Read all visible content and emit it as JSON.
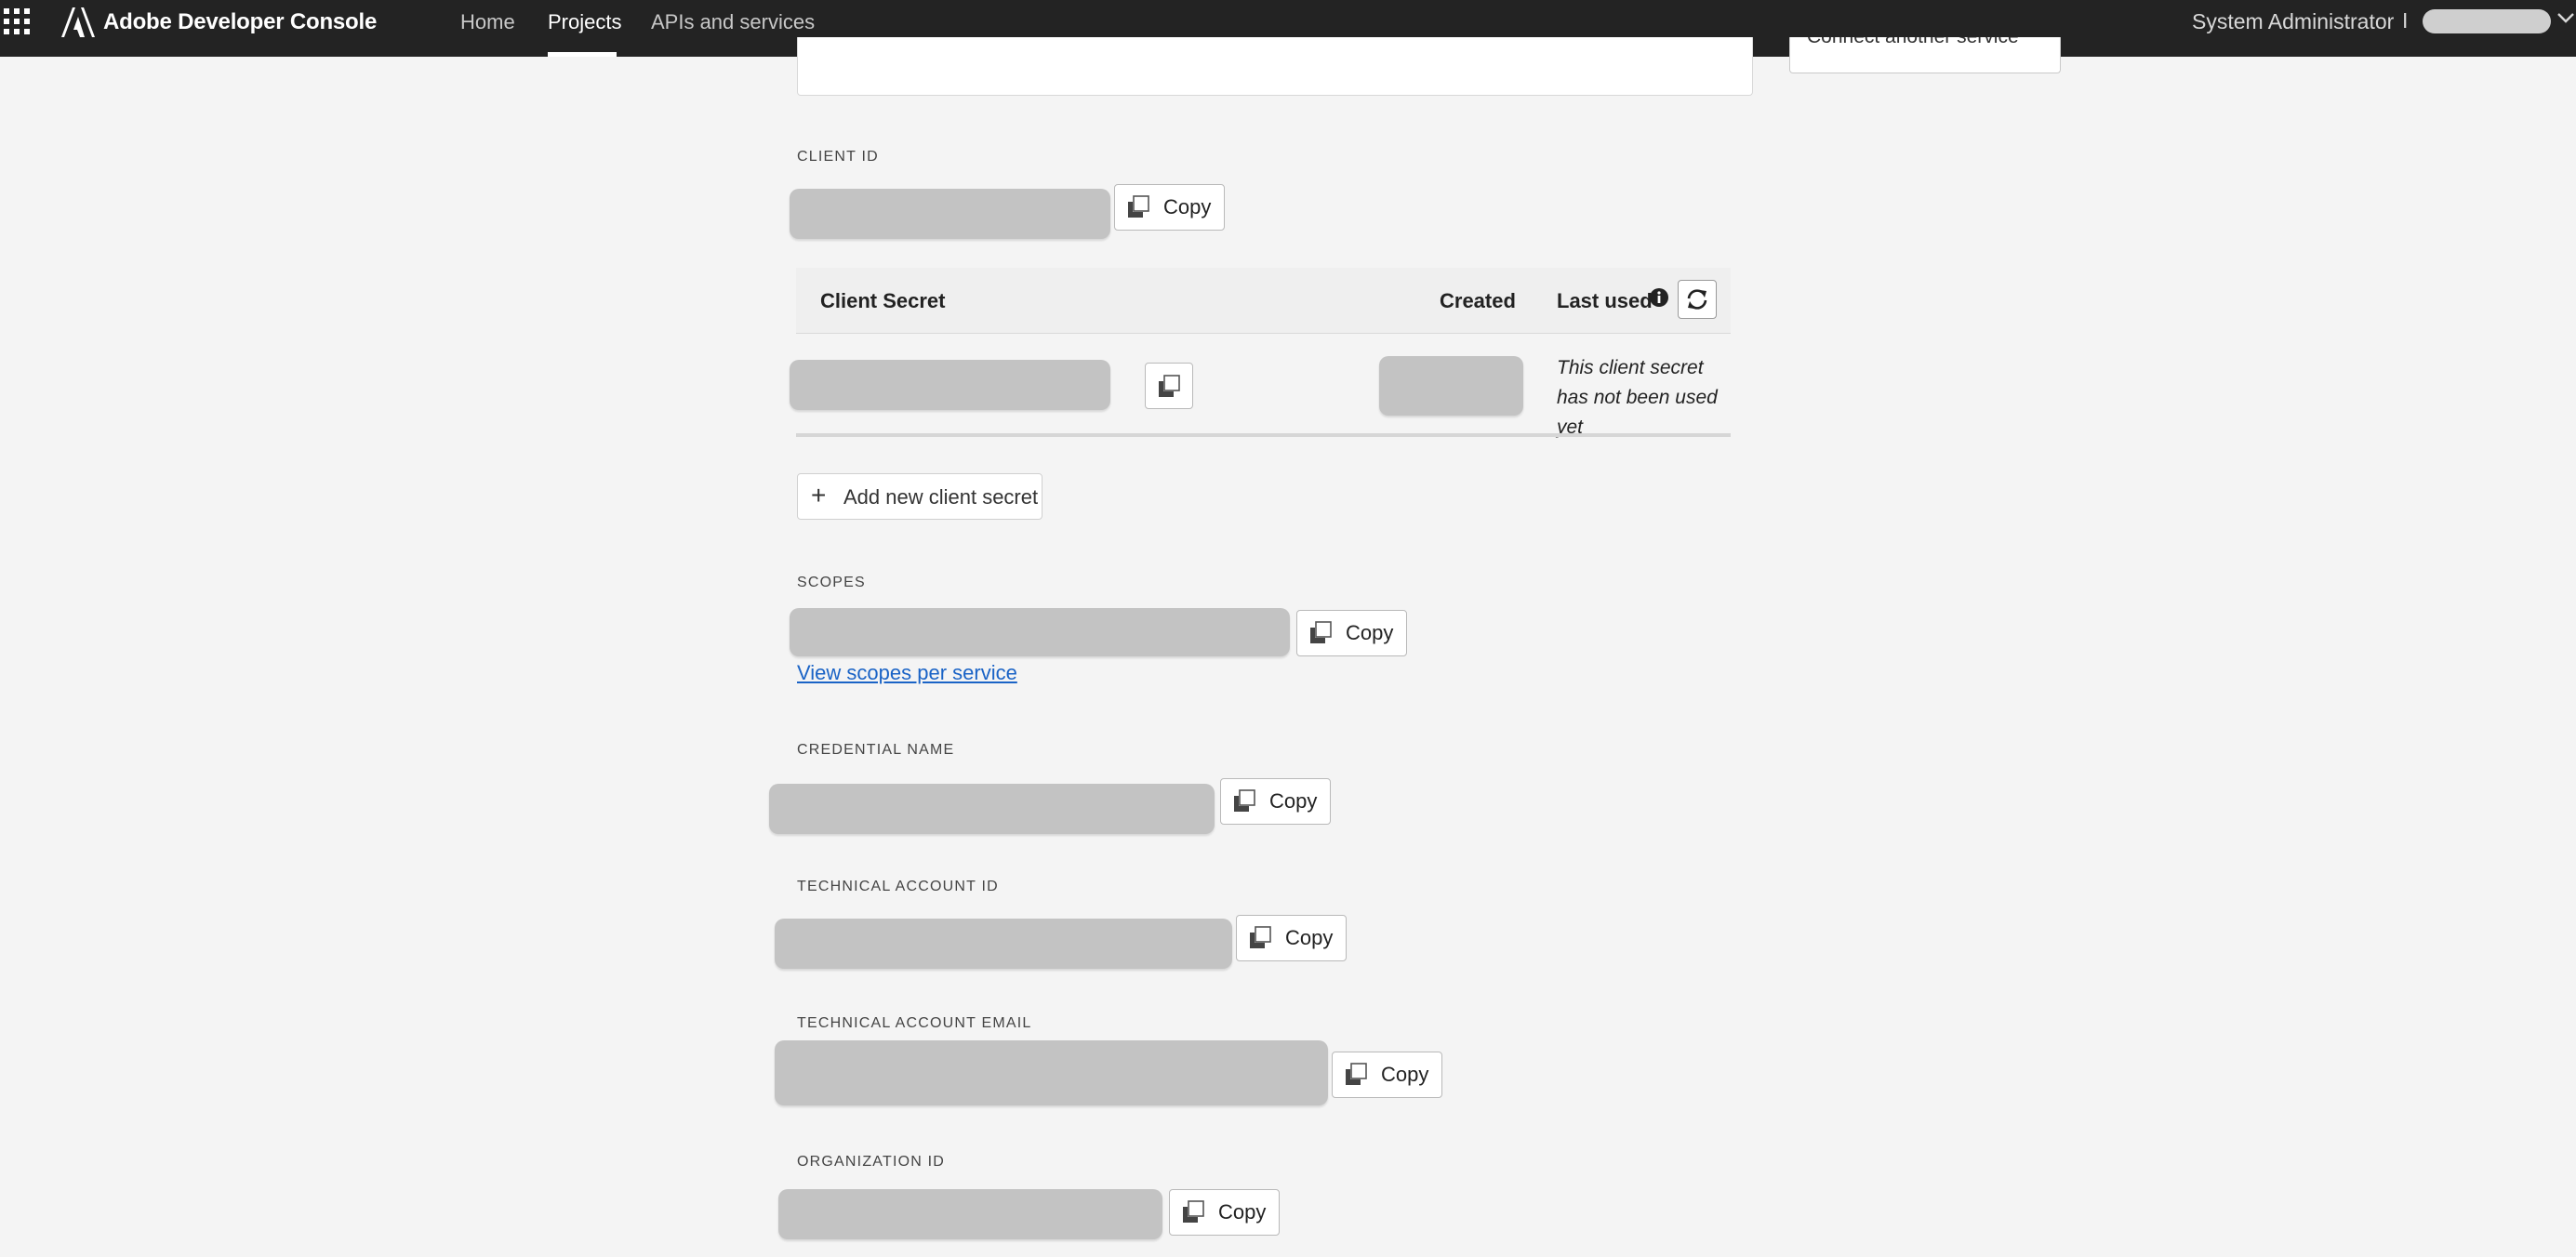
{
  "header": {
    "brand": "Adobe Developer Console",
    "nav": [
      {
        "label": "Home"
      },
      {
        "label": "Projects",
        "active": true
      },
      {
        "label": "APIs and services"
      }
    ],
    "user_name": "System Administrator",
    "separator": "I"
  },
  "connect_button": {
    "label": "Connect another service"
  },
  "client_id": {
    "label": "CLIENT ID",
    "copy_label": "Copy"
  },
  "client_secret_table": {
    "columns": {
      "secret": "Client Secret",
      "created": "Created",
      "last_used": "Last used"
    },
    "rows": [
      {
        "last_used_text": "This client secret has not been used yet"
      }
    ]
  },
  "add_secret": {
    "label": "Add new client secret",
    "icon": "plus-icon"
  },
  "scopes": {
    "label": "SCOPES",
    "copy_label": "Copy",
    "link": "View scopes per service"
  },
  "credential_name": {
    "label": "CREDENTIAL NAME",
    "copy_label": "Copy"
  },
  "technical_account_id": {
    "label": "TECHNICAL ACCOUNT ID",
    "copy_label": "Copy"
  },
  "technical_account_email": {
    "label": "TECHNICAL ACCOUNT EMAIL",
    "copy_label": "Copy"
  },
  "organization_id": {
    "label": "ORGANIZATION ID",
    "copy_label": "Copy"
  },
  "colors": {
    "topbar": "#232323",
    "background": "#f4f4f4",
    "link": "#1a63c6",
    "redacted": "#c3c3c3"
  }
}
